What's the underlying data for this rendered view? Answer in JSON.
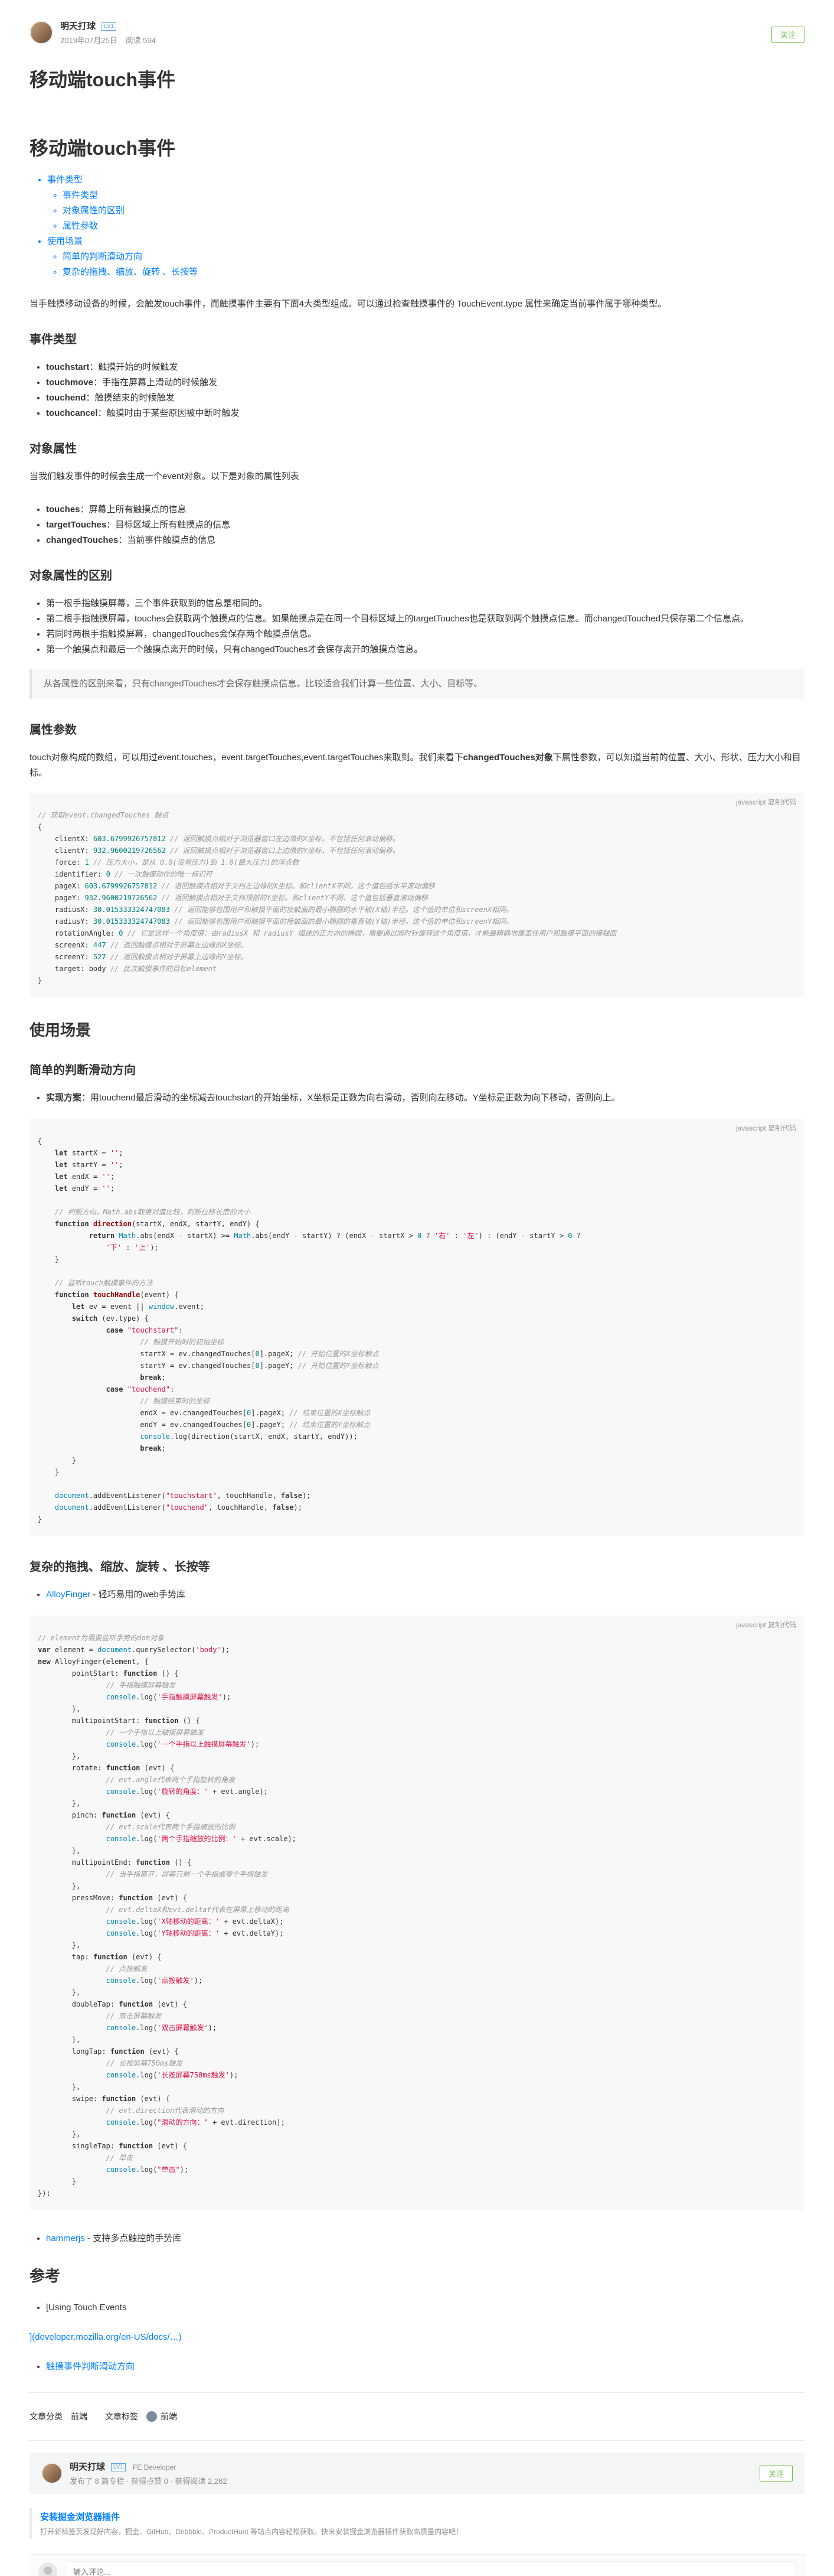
{
  "author": {
    "name": "明天打球",
    "level": "LV1",
    "date": "2019年07月25日",
    "reads": "阅读 594",
    "follow_label": "关注"
  },
  "title": "移动端touch事件",
  "article_h1": "移动端touch事件",
  "toc": {
    "events": "事件类型",
    "events_types": "事件类型",
    "events_diff": "对象属性的区别",
    "events_params": "属性参数",
    "scenes": "使用场景",
    "scene_simple": "简单的判断滑动方向",
    "scene_complex": "复杂的拖拽、缩放、旋转 、长按等"
  },
  "intro": "当手触摸移动设备的时候，会触发touch事件，而触摸事件主要有下面4大类型组成。可以通过检查触摸事件的 TouchEvent.type 属性来确定当前事件属于哪种类型。",
  "sec_types": "事件类型",
  "types": [
    {
      "name": "touchstart",
      "desc": "：触摸开始的时候触发"
    },
    {
      "name": "touchmove",
      "desc": "：手指在屏幕上滑动的时候触发"
    },
    {
      "name": "touchend",
      "desc": "：触摸结束的时候触发"
    },
    {
      "name": "touchcancel",
      "desc": "：触摸时由于某些原因被中断时触发"
    }
  ],
  "sec_obj": "对象属性",
  "obj_intro": "当我们触发事件的时候会生成一个event对象。以下是对象的属性列表",
  "obj_props": [
    {
      "name": "touches",
      "desc": "：屏幕上所有触摸点的信息"
    },
    {
      "name": "targetTouches",
      "desc": "：目标区域上所有触摸点的信息"
    },
    {
      "name": "changedTouches",
      "desc": "：当前事件触摸点的信息"
    }
  ],
  "sec_diff": "对象属性的区别",
  "diff_items": [
    "第一根手指触摸屏幕，三个事件获取到的信息是相同的。",
    "第二根手指触摸屏幕，touches会获取两个触摸点的信息。如果触摸点是在同一个目标区域上的targetTouches也是获取到两个触摸点信息。而changedTouched只保存第二个信息点。",
    "若同时两根手指触摸屏幕，changedTouches会保存两个触摸点信息。",
    "第一个触摸点和最后一个触摸点离开的时候，只有changedTouches才会保存离开的触摸点信息。"
  ],
  "diff_quote": "从各属性的区别来看，只有changedTouches才会保存触摸点信息。比较适合我们计算一些位置、大小、目标等。",
  "sec_params": "属性参数",
  "params_intro_a": "touch对象构成的数组，可以用过event.touches，event.targetTouches,event.targetTouches来取到。我们来看下",
  "params_intro_b": "changedTouches对象",
  "params_intro_c": "下属性参数，可以知道当前的位置、大小、形状、压力大小和目标。",
  "code_lang": "javascript 复制代码",
  "sec_scenes": "使用场景",
  "sec_simple": "简单的判断滑动方向",
  "simple_label": "实现方案",
  "simple_desc": "：用touchend最后滑动的坐标减去touchstart的开始坐标，X坐标是正数为向右滑动，否则向左移动。Y坐标是正数为向下移动，否则向上。",
  "sec_complex": "复杂的拖拽、缩放、旋转 、长按等",
  "alloy_link": "AlloyFinger",
  "alloy_desc": " - 轻巧易用的web手势库",
  "hammer_link": "hammerjs",
  "hammer_desc": " - 支持多点触控的手势库",
  "sec_refs": "参考",
  "ref1": "[Using Touch Events",
  "ref2": "](developer.mozilla.org/en-US/docs/…)",
  "ref3": "触摸事件判断滑动方向",
  "tags": {
    "category_label": "文章分类",
    "category_value": "前端",
    "tag_label": "文章标签",
    "tag_value": "前端"
  },
  "card": {
    "name": "明天打球",
    "level": "LV1",
    "title": "FE Developer",
    "stats": "发布了 8 篇专栏 · 获得点赞 0 · 获得阅读 2,262",
    "follow_label": "关注"
  },
  "recommend": {
    "title": "安装掘金浏览器插件",
    "desc": "打开新标签页发现好内容，掘金、GitHub、Dribbble、ProductHunt 等站点内容轻松获取。快来安装掘金浏览器插件获取高质量内容吧！"
  },
  "comment": {
    "placeholder": "输入评论..."
  }
}
